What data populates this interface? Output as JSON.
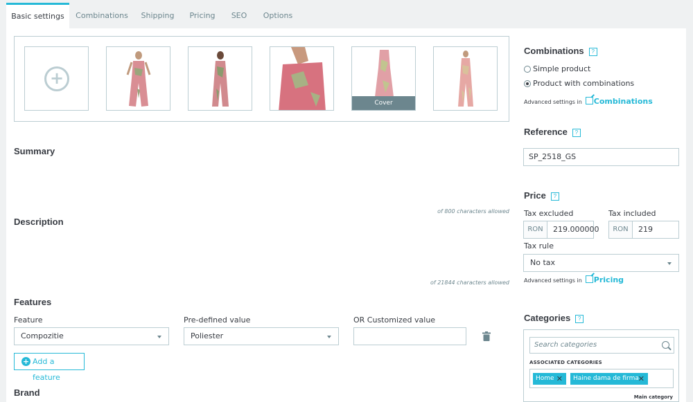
{
  "tabs": [
    "Basic settings",
    "Combinations",
    "Shipping",
    "Pricing",
    "SEO",
    "Options"
  ],
  "gallery": {
    "add_icon": "plus-circle-icon",
    "cover_label": "Cover",
    "images": [
      {
        "name": "product-image-1",
        "colors": [
          "#d98e94",
          "#9aa57c"
        ]
      },
      {
        "name": "product-image-2",
        "colors": [
          "#d18a8e",
          "#8b9b6e"
        ]
      },
      {
        "name": "product-image-3",
        "colors": [
          "#d7727f",
          "#a7b184"
        ]
      },
      {
        "name": "product-image-4",
        "colors": [
          "#e1a0a6",
          "#c1c48f"
        ]
      },
      {
        "name": "product-image-5",
        "colors": [
          "#e6a8a4",
          "#d9c19b"
        ]
      }
    ]
  },
  "summary": {
    "title": "Summary",
    "hint": "of 800 characters allowed"
  },
  "description": {
    "title": "Description",
    "hint": "of 21844 characters allowed"
  },
  "features": {
    "title": "Features",
    "col_feature": "Feature",
    "col_predefined": "Pre-defined value",
    "col_custom": "OR Customized value",
    "feature_value": "Compozitie",
    "predefined_value": "Poliester",
    "custom_value": "",
    "add_label": "Add a feature"
  },
  "brand": {
    "title": "Brand"
  },
  "combinations": {
    "title": "Combinations",
    "help": "?",
    "option_simple": "Simple product",
    "option_combinations": "Product with combinations",
    "selected": "combinations",
    "advanced_prefix": "Advanced settings in",
    "advanced_link": "Combinations"
  },
  "reference": {
    "title": "Reference",
    "help": "?",
    "value": "SP_2518_GS"
  },
  "price": {
    "title": "Price",
    "help": "?",
    "tax_excluded_label": "Tax excluded",
    "tax_included_label": "Tax included",
    "currency": "RON",
    "tax_excluded_value": "219.000000",
    "tax_included_value": "219",
    "tax_rule_label": "Tax rule",
    "tax_rule_value": "No tax",
    "advanced_prefix": "Advanced settings in",
    "advanced_link": "Pricing"
  },
  "categories": {
    "title": "Categories",
    "help": "?",
    "search_placeholder": "Search categories",
    "associated_label": "ASSOCIATED CATEGORIES",
    "tags": [
      "Home",
      "Haine dama de firma"
    ],
    "main_category_label": "Main category"
  },
  "colors": {
    "accent": "#25b9d7",
    "border": "#bbcdd2",
    "muted": "#6c868e"
  }
}
